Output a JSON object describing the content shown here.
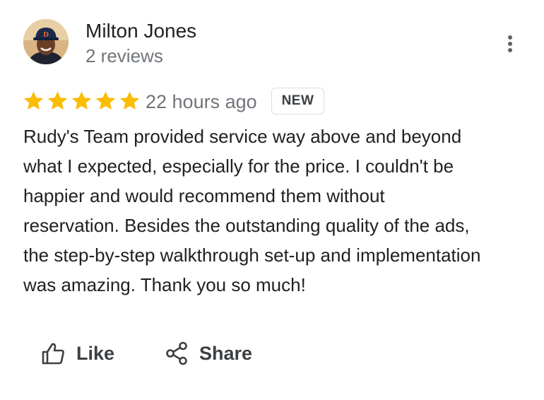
{
  "reviewer": {
    "name": "Milton Jones",
    "reviews": "2 reviews"
  },
  "review": {
    "rating": 5,
    "max_rating": 5,
    "time": "22 hours ago",
    "badge": "NEW",
    "text": "Rudy's Team provided service way above and beyond\nwhat I expected, especially for the price. I couldn't be\nhappier and would recommend them without\nreservation. Besides the outstanding quality of the ads,\nthe step-by-step walkthrough set-up and implementation\nwas amazing. Thank you so much!"
  },
  "actions": {
    "like_label": "Like",
    "share_label": "Share"
  },
  "colors": {
    "star": "#fbbc04",
    "secondary_text": "#70757a",
    "action_text": "#3c4043"
  },
  "icons": {
    "more": "more-vert-icon",
    "like": "thumb-up-icon",
    "share": "share-icon",
    "star": "star-icon"
  }
}
